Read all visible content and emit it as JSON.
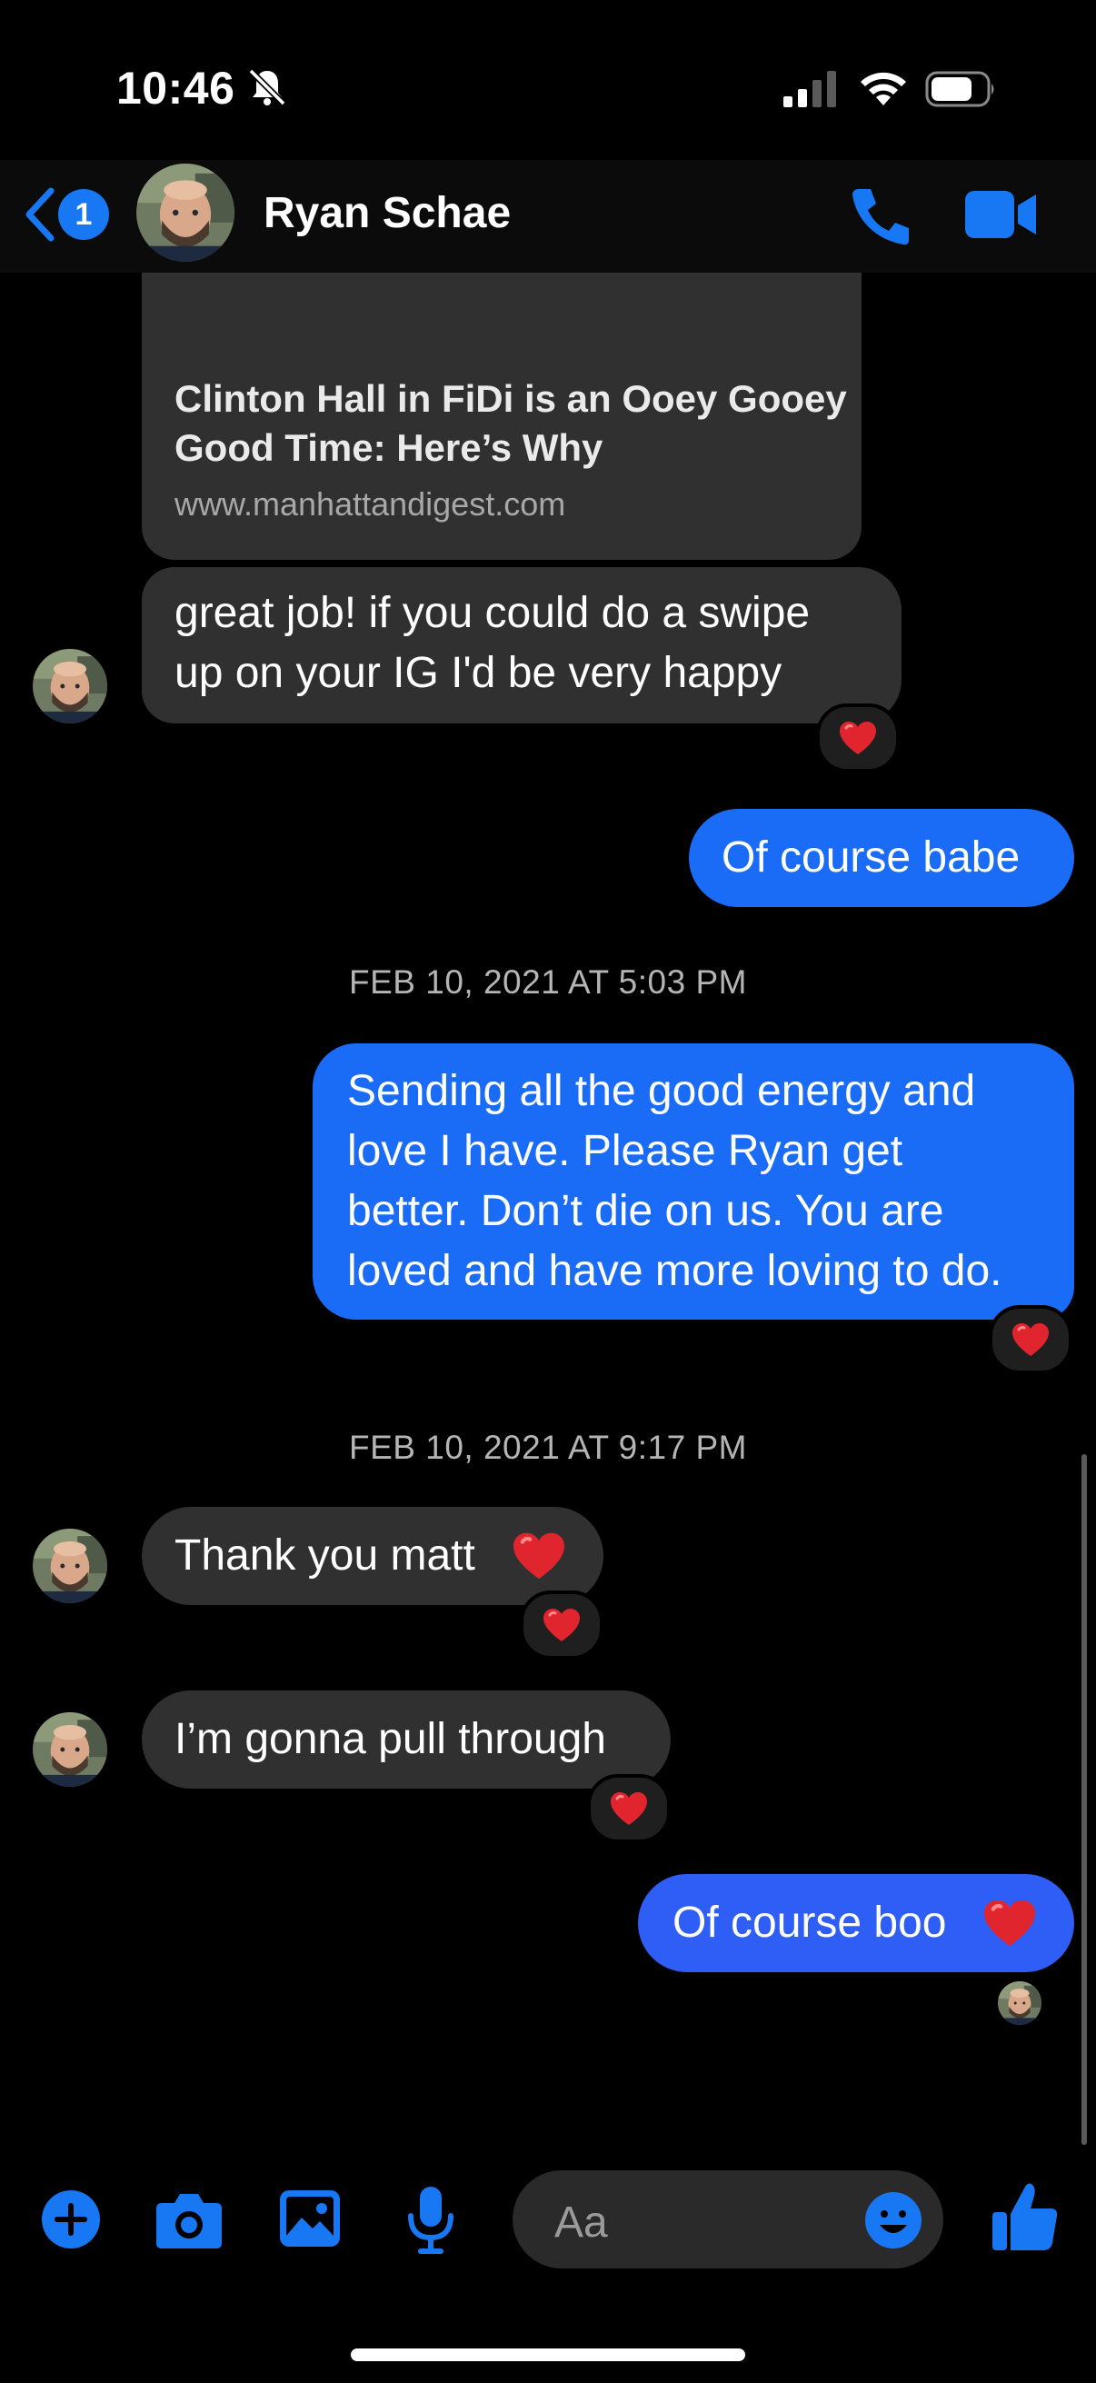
{
  "status_bar": {
    "time": "10:46"
  },
  "header": {
    "contact_name": "Ryan Schae",
    "back_badge": "1"
  },
  "link_preview": {
    "title": "Clinton Hall in FiDi is an Ooey Gooey Good Time: Here’s Why",
    "domain": "www.manhattandigest.com"
  },
  "messages": [
    {
      "direction": "in",
      "lines": [
        "great job! if you could do a swipe",
        "up on your IG I'd be very happy"
      ],
      "reaction": "heart"
    },
    {
      "direction": "out",
      "text": "Of course babe"
    },
    {
      "timestamp": "FEB 10, 2021 AT 5:03 PM"
    },
    {
      "direction": "out",
      "lines": [
        "Sending all the good energy and",
        "love I have. Please Ryan get",
        "better. Don’t die on us. You are",
        "loved and have more loving to do."
      ],
      "reaction": "heart"
    },
    {
      "timestamp": "FEB 10, 2021 AT 9:17 PM"
    },
    {
      "direction": "in",
      "text": "Thank you matt",
      "emoji": "heart",
      "reaction": "heart"
    },
    {
      "direction": "in",
      "text": "I’m gonna pull through",
      "reaction": "heart"
    },
    {
      "direction": "out",
      "text": "Of course boo",
      "emoji": "heart",
      "seen_by": "contact-avatar"
    }
  ],
  "composer": {
    "placeholder": "Aa"
  },
  "icons": [
    "bell-slash-icon",
    "signal-icon",
    "wifi-icon",
    "battery-icon",
    "back-chevron-icon",
    "phone-icon",
    "video-camera-icon",
    "heart-icon",
    "plus-icon",
    "camera-icon",
    "photo-icon",
    "microphone-icon",
    "emoji-icon",
    "thumbs-up-icon"
  ],
  "colors": {
    "accent": "#1877f2",
    "outgoing_bubble": "#1a6cf7",
    "incoming_bubble": "#303030",
    "background": "#000000",
    "heart": "#e0252f"
  }
}
